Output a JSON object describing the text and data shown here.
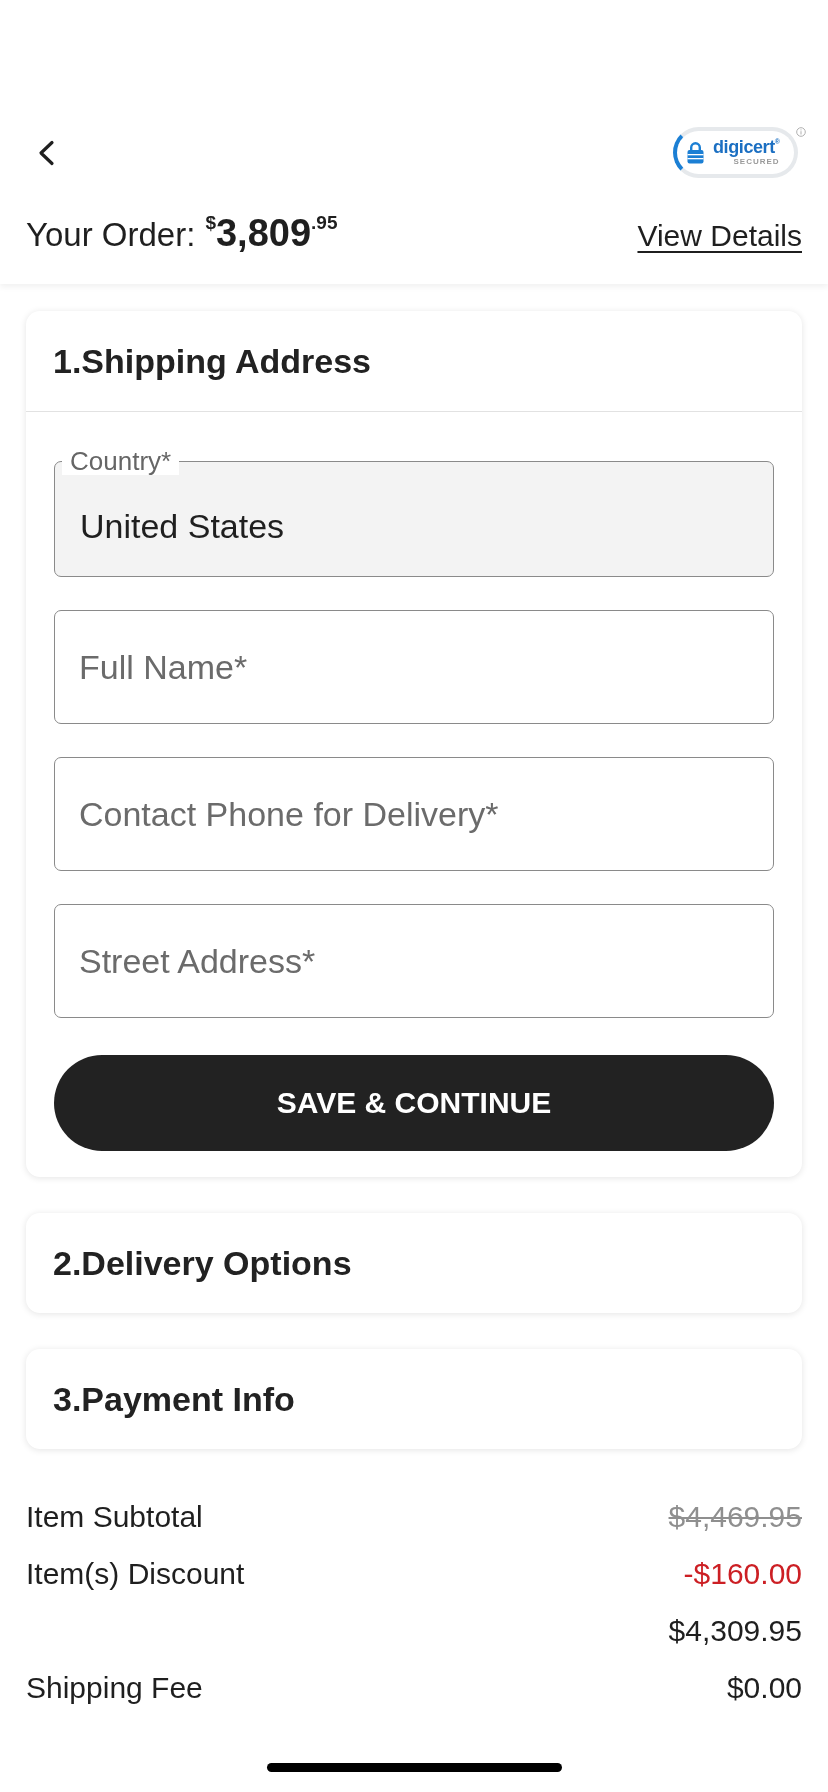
{
  "header": {
    "seal": {
      "brand": "digicert$^{®}$",
      "caption": "SECURED"
    },
    "order": {
      "label": "Your Order:",
      "currency": "$",
      "whole": "3,809",
      "fraction": ".95"
    },
    "view_details": "View Details"
  },
  "sections": [
    {
      "title": "1.Shipping Address",
      "expanded": true,
      "fields": [
        {
          "label": "Country*",
          "value": "United States",
          "disabled": true
        },
        {
          "placeholder": "Full Name*",
          "disabled": false
        },
        {
          "placeholder": "Contact Phone for Delivery*",
          "disabled": false
        },
        {
          "placeholder": "Street Address*",
          "disabled": false
        }
      ],
      "button": "SAVE & CONTINUE"
    },
    {
      "title": "2.Delivery Options",
      "expanded": false
    },
    {
      "title": "3.Payment Info",
      "expanded": false
    }
  ],
  "summary": [
    {
      "label": "Item Subtotal",
      "value": "$4,469.95",
      "kind": "strikethrough"
    },
    {
      "label": "Item(s) Discount",
      "value": "-$160.00",
      "kind": "discount"
    },
    {
      "value": "$4,309.95",
      "kind": "plain"
    },
    {
      "label": "Shipping Fee",
      "value": "$0.00",
      "kind": "plain"
    }
  ]
}
